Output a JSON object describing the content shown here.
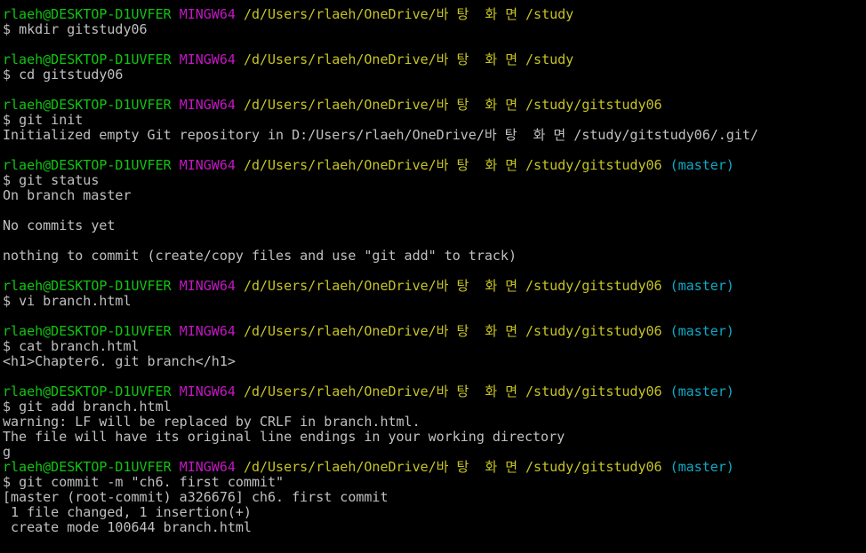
{
  "colors": {
    "background": "#000000",
    "text": "#c0c0c0",
    "user_host": "#11c511",
    "msystem": "#c516c5",
    "path": "#c7c423",
    "branch": "#0fa9c5"
  },
  "prompt": {
    "user_host": "rlaeh@DESKTOP-D1UVFER",
    "msystem": "MINGW64",
    "symbol": "$ "
  },
  "lines": [
    {
      "kind": "prompt",
      "path": "/d/Users/rlaeh/OneDrive/바 탕  화 면 /study",
      "branch": ""
    },
    {
      "kind": "cmd",
      "text": "mkdir gitstudy06"
    },
    {
      "kind": "blank",
      "text": ""
    },
    {
      "kind": "prompt",
      "path": "/d/Users/rlaeh/OneDrive/바 탕  화 면 /study",
      "branch": ""
    },
    {
      "kind": "cmd",
      "text": "cd gitstudy06"
    },
    {
      "kind": "blank",
      "text": ""
    },
    {
      "kind": "prompt",
      "path": "/d/Users/rlaeh/OneDrive/바 탕  화 면 /study/gitstudy06",
      "branch": ""
    },
    {
      "kind": "cmd",
      "text": "git init"
    },
    {
      "kind": "out",
      "text": "Initialized empty Git repository in D:/Users/rlaeh/OneDrive/바 탕  화 면 /study/gitstudy06/.git/"
    },
    {
      "kind": "blank",
      "text": ""
    },
    {
      "kind": "prompt",
      "path": "/d/Users/rlaeh/OneDrive/바 탕  화 면 /study/gitstudy06",
      "branch": "(master)"
    },
    {
      "kind": "cmd",
      "text": "git status"
    },
    {
      "kind": "out",
      "text": "On branch master"
    },
    {
      "kind": "blank",
      "text": ""
    },
    {
      "kind": "out",
      "text": "No commits yet"
    },
    {
      "kind": "blank",
      "text": ""
    },
    {
      "kind": "out",
      "text": "nothing to commit (create/copy files and use \"git add\" to track)"
    },
    {
      "kind": "blank",
      "text": ""
    },
    {
      "kind": "prompt",
      "path": "/d/Users/rlaeh/OneDrive/바 탕  화 면 /study/gitstudy06",
      "branch": "(master)"
    },
    {
      "kind": "cmd",
      "text": "vi branch.html"
    },
    {
      "kind": "blank",
      "text": ""
    },
    {
      "kind": "prompt",
      "path": "/d/Users/rlaeh/OneDrive/바 탕  화 면 /study/gitstudy06",
      "branch": "(master)"
    },
    {
      "kind": "cmd",
      "text": "cat branch.html"
    },
    {
      "kind": "out",
      "text": "<h1>Chapter6. git branch</h1>"
    },
    {
      "kind": "blank",
      "text": ""
    },
    {
      "kind": "prompt",
      "path": "/d/Users/rlaeh/OneDrive/바 탕  화 면 /study/gitstudy06",
      "branch": "(master)"
    },
    {
      "kind": "cmd",
      "text": "git add branch.html"
    },
    {
      "kind": "out",
      "text": "warning: LF will be replaced by CRLF in branch.html."
    },
    {
      "kind": "out",
      "text": "The file will have its original line endings in your working directory"
    },
    {
      "kind": "out",
      "text": "g"
    },
    {
      "kind": "prompt",
      "path": "/d/Users/rlaeh/OneDrive/바 탕  화 면 /study/gitstudy06",
      "branch": "(master)"
    },
    {
      "kind": "cmd",
      "text": "git commit -m \"ch6. first commit\""
    },
    {
      "kind": "out",
      "text": "[master (root-commit) a326676] ch6. first commit"
    },
    {
      "kind": "out",
      "text": " 1 file changed, 1 insertion(+)"
    },
    {
      "kind": "out",
      "text": " create mode 100644 branch.html"
    }
  ]
}
